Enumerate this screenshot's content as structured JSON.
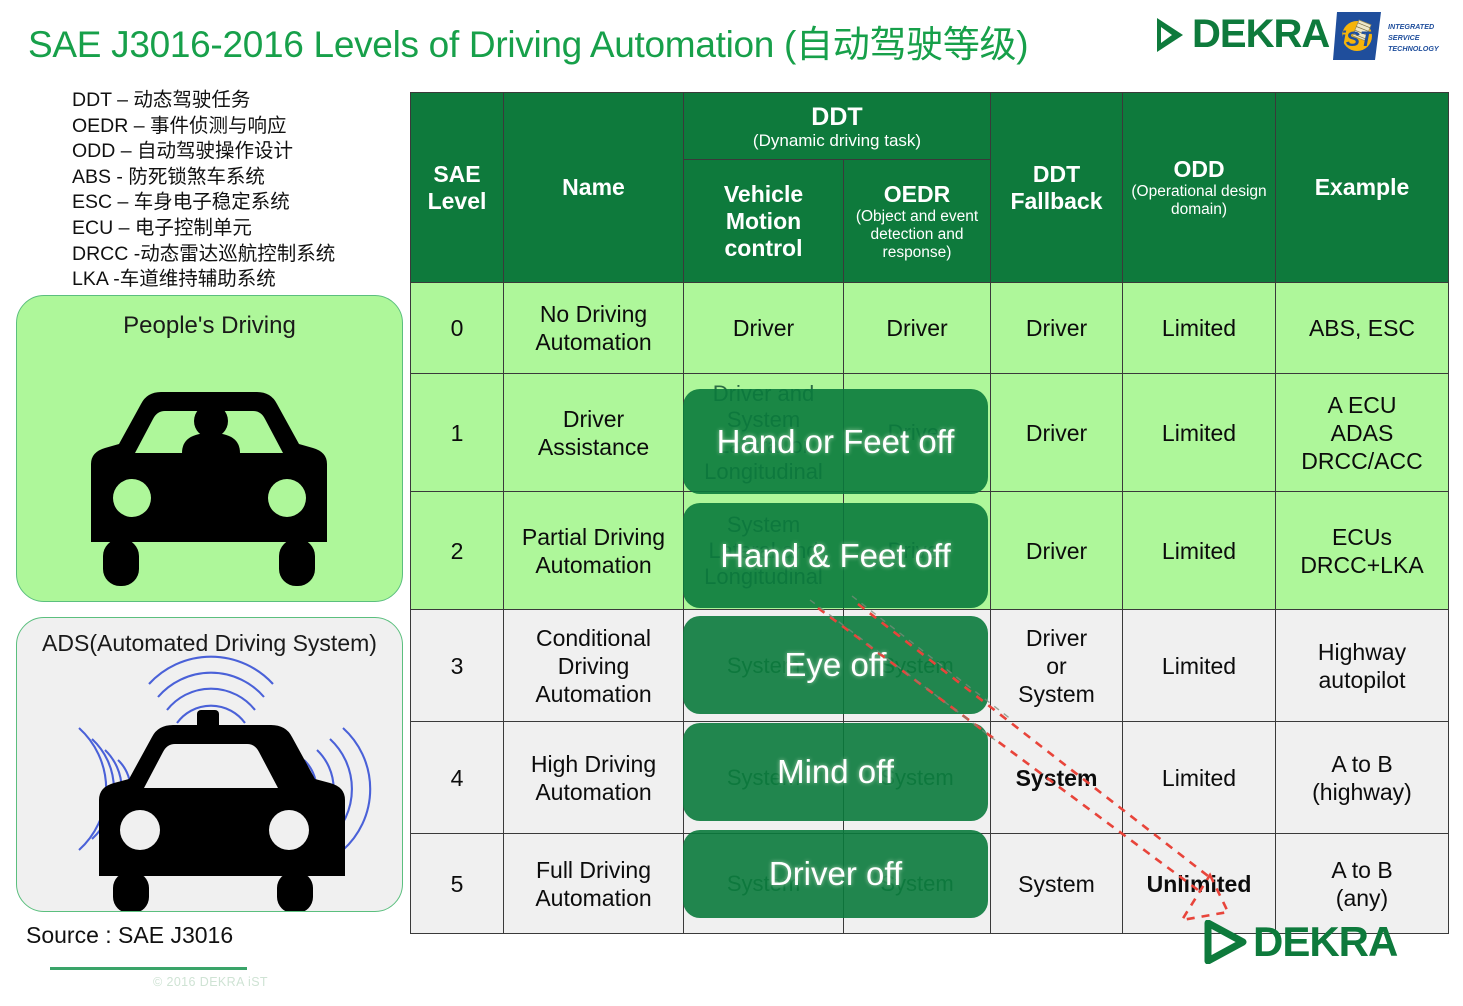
{
  "header": {
    "title": "SAE J3016-2016 Levels of Driving Automation (自动驾驶等级)",
    "brand": "DEKRA",
    "badge_lines": [
      "INTEGRATED",
      "SERVICE",
      "TECHNOLOGY"
    ],
    "badge_mark": "iST",
    "accent_green": "#17A04A",
    "brand_green": "#0E7A3C",
    "badge_blue": "#1F4E9C",
    "badge_yellow": "#F5B40A"
  },
  "legend": {
    "lines": [
      "DDT – 动态驾驶任务",
      "OEDR – 事件侦测与响应",
      "ODD – 自动驾驶操作设计",
      "ABS - 防死锁煞车系统",
      "ESC – 车身电子稳定系统",
      "ECU – 电子控制单元",
      "DRCC -动态雷达巡航控制系统",
      "LKA -车道维持辅助系统"
    ]
  },
  "cards": [
    {
      "id": "people",
      "label": "People's Driving",
      "icon": "car-with-driver-icon",
      "bg": "#AEF79A"
    },
    {
      "id": "ads",
      "label": "ADS(Automated Driving System)",
      "icon": "autonomous-car-sensor-icon",
      "bg": "#F0F0F0"
    }
  ],
  "table": {
    "group_header": {
      "label": "DDT",
      "sub": "(Dynamic driving task)"
    },
    "columns": [
      {
        "key": "level",
        "label": "SAE\nLevel",
        "label_l1": "SAE",
        "label_l2": "Level"
      },
      {
        "key": "name",
        "label": "Name"
      },
      {
        "key": "vmc",
        "label": "Vehicle Motion control",
        "label_l1": "Vehicle",
        "label_l2": "Motion",
        "label_l3": "control"
      },
      {
        "key": "oedr",
        "label": "OEDR",
        "sub": "(Object and event detection and response)"
      },
      {
        "key": "fallback",
        "label": "DDT Fallback",
        "label_l1": "DDT",
        "label_l2": "Fallback"
      },
      {
        "key": "odd",
        "label": "ODD",
        "sub": "(Operational design domain)"
      },
      {
        "key": "example",
        "label": "Example"
      }
    ],
    "rows": [
      {
        "level": "0",
        "name": "No Driving Automation",
        "vmc": "Driver",
        "oedr": "Driver",
        "fallback": "Driver",
        "odd": "Limited",
        "example": "ABS, ESC",
        "tone": "light",
        "fallback_bold": false,
        "odd_bold": false
      },
      {
        "level": "1",
        "name": "Driver Assistance",
        "vmc": "Driver and System\nLateral  or\nLongitudinal",
        "oedr": "Driver",
        "fallback": "Driver",
        "odd": "Limited",
        "example": "A ECU\nADAS\nDRCC/ACC",
        "tone": "light",
        "fallback_bold": false,
        "odd_bold": false
      },
      {
        "level": "2",
        "name": "Partial Driving Automation",
        "vmc": "System\nLateral and\nLongitudinal",
        "oedr": "Driver",
        "fallback": "Driver",
        "odd": "Limited",
        "example": "ECUs\nDRCC+LKA",
        "tone": "light",
        "fallback_bold": false,
        "odd_bold": false
      },
      {
        "level": "3",
        "name": "Conditional Driving Automation",
        "vmc": "System",
        "oedr": "System",
        "fallback": "Driver\nor\nSystem",
        "odd": "Limited",
        "example": "Highway\nautopilot",
        "tone": "grey",
        "fallback_bold": false,
        "odd_bold": false
      },
      {
        "level": "4",
        "name": "High Driving Automation",
        "vmc": "System",
        "oedr": "System",
        "fallback": "System",
        "odd": "Limited",
        "example": "A to B\n(highway)",
        "tone": "grey",
        "fallback_bold": true,
        "odd_bold": false
      },
      {
        "level": "5",
        "name": "Full Driving Automation",
        "vmc": "System",
        "oedr": "System",
        "fallback": "System",
        "odd": "Unlimited",
        "example": "A to B\n(any)",
        "tone": "grey",
        "fallback_bold": false,
        "odd_bold": true
      }
    ],
    "overlays": [
      {
        "id": "ov-1",
        "label": "Hand or Feet off",
        "row_level": "1"
      },
      {
        "id": "ov-2",
        "label": "Hand & Feet off",
        "row_level": "2"
      },
      {
        "id": "ov-3",
        "label": "Eye off",
        "row_level": "3"
      },
      {
        "id": "ov-4",
        "label": "Mind off",
        "row_level": "4"
      },
      {
        "id": "ov-5",
        "label": "Driver off",
        "row_level": "5"
      }
    ],
    "header_bg": "#0E7A3C",
    "row_light_bg": "#AEF79A",
    "row_grey_bg": "#F0F0F0",
    "overlay_bg": "#0A7A3C"
  },
  "annotation": {
    "arrow_color": "#E8443A",
    "style": "red-dashed-arrow"
  },
  "footer": {
    "source": "Source : SAE J3016",
    "copyright": "© 2016 DEKRA iST",
    "brand": "DEKRA"
  }
}
